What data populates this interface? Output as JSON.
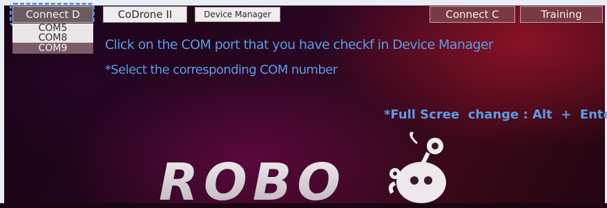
{
  "toolbar": {
    "connect_d": "Connect D",
    "codrone": "CoDrone II",
    "device_manager": "Device Manager",
    "connect_c": "Connect C",
    "training": "Training"
  },
  "com_ports": [
    {
      "label": "COM5",
      "selected": false
    },
    {
      "label": "COM8",
      "selected": false
    },
    {
      "label": "COM9",
      "selected": true
    }
  ],
  "instructions": {
    "line1": "Click on the COM port that you have checkf in Device Manager",
    "line2": "*Select the corresponding COM number"
  },
  "fullscreen_hint": "*Full Scree  change : Alt  +  Enter",
  "logo": {
    "text": "ROBO"
  },
  "colors": {
    "accent_text": "#5b9ce6",
    "maroon_button": "#7a3a44",
    "focus_ring": "#5b8fe0"
  }
}
